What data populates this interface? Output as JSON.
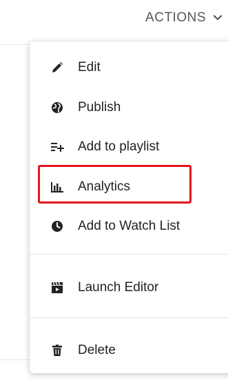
{
  "header": {
    "actions_label": "ACTIONS",
    "chevron_icon": "chevron-down-icon"
  },
  "menu": {
    "items": [
      {
        "label": "Edit",
        "icon": "pencil-icon"
      },
      {
        "label": "Publish",
        "icon": "globe-icon"
      },
      {
        "label": "Add to playlist",
        "icon": "playlist-add-icon"
      },
      {
        "label": "Analytics",
        "icon": "bar-chart-icon"
      },
      {
        "label": "Add to Watch List",
        "icon": "clock-icon"
      },
      {
        "label": "Launch Editor",
        "icon": "clapperboard-icon"
      },
      {
        "label": "Delete",
        "icon": "trash-icon"
      }
    ],
    "highlighted_item": "Analytics"
  },
  "colors": {
    "highlight_border": "#e3141c",
    "text": "#222222",
    "muted_text": "#555555"
  }
}
